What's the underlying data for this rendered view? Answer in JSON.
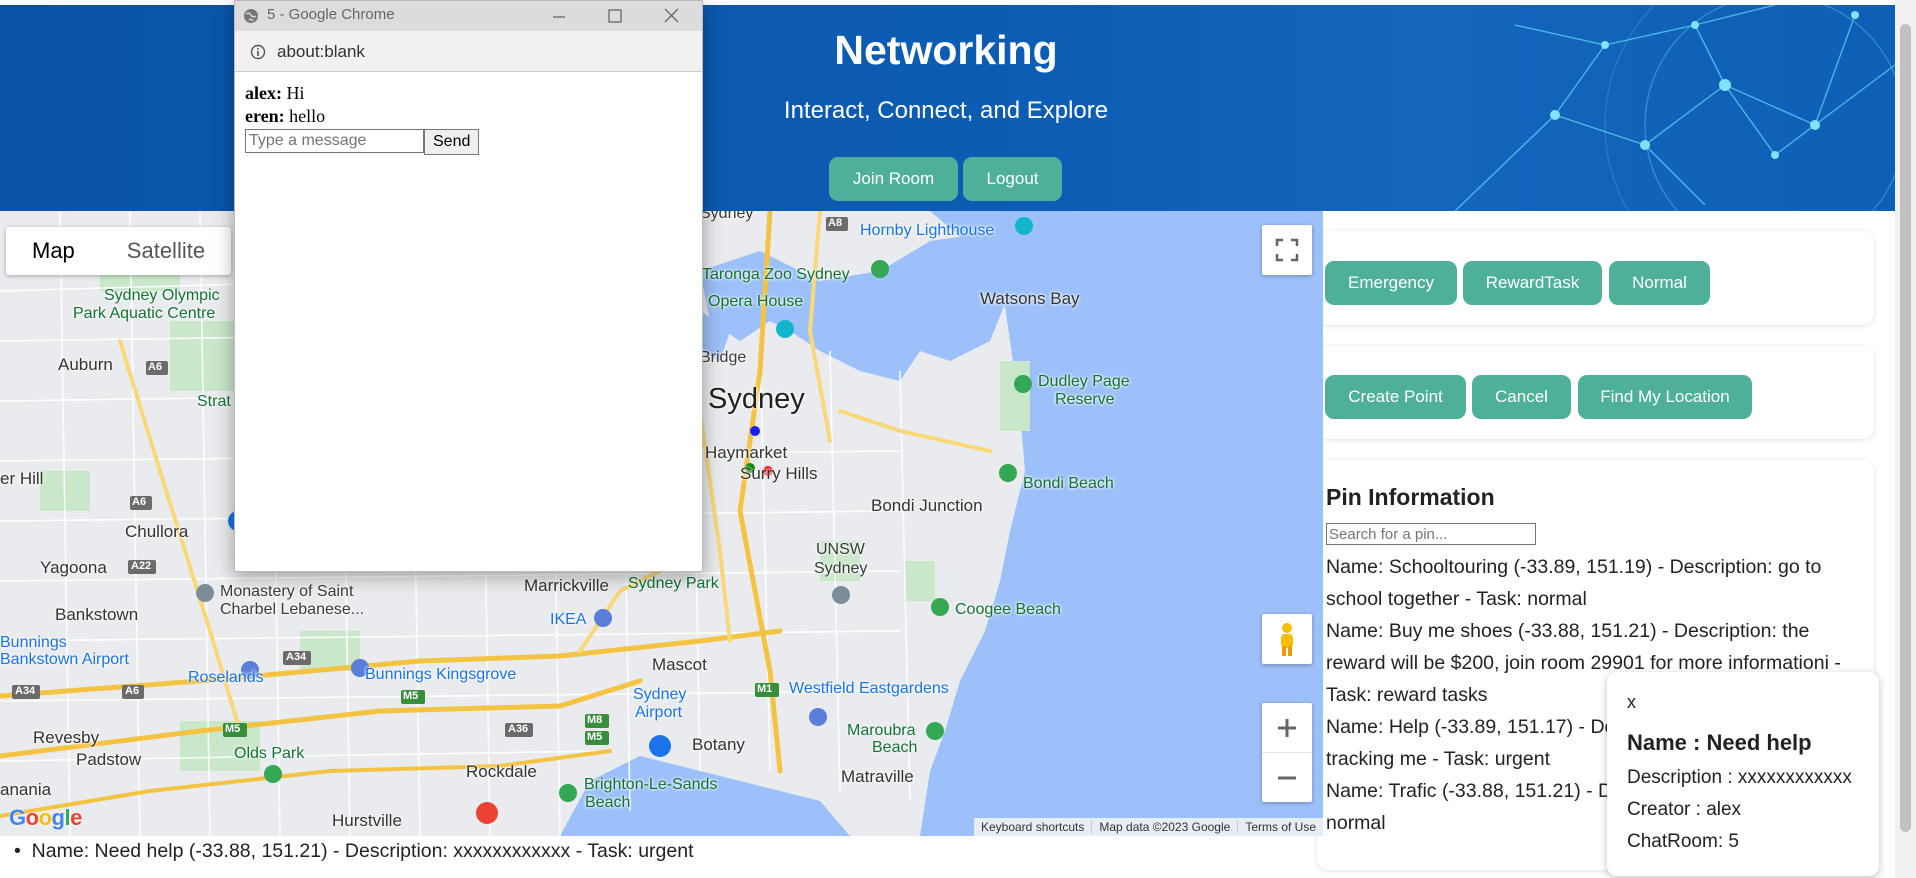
{
  "header": {
    "title": "Networking",
    "subtitle": "Interact, Connect, and Explore",
    "join_room": "Join Room",
    "logout": "Logout"
  },
  "filters": {
    "emergency": "Emergency",
    "reward_task": "RewardTask",
    "normal": "Normal"
  },
  "actions": {
    "create_point": "Create Point",
    "cancel": "Cancel",
    "find_location": "Find My Location"
  },
  "pins": {
    "title": "Pin Information",
    "search_placeholder": "Search for a pin...",
    "items": [
      "Name: Schooltouring (-33.89, 151.19) - Description: go to school together - Task: normal",
      "Name: Buy me shoes (-33.88, 151.21) - Description: the reward will be $200, join room 29901 for more informationi - Task: reward tasks",
      "Name: Help (-33.89, 151.17) - Description: someone is tracking me - Task: urgent",
      "Name: Trafic (-33.88, 151.21) - Description: traffic jam - Task: normal"
    ]
  },
  "popup": {
    "close": "x",
    "name": "Name : Need help",
    "description": "Description : xxxxxxxxxxxx",
    "creator": "Creator : alex",
    "chatroom": "ChatRoom: 5"
  },
  "bottom_list": {
    "item": "Name: Need help (-33.88, 151.21) - Description: xxxxxxxxxxxx - Task: urgent"
  },
  "map": {
    "type_map": "Map",
    "type_satellite": "Satellite",
    "google": "Google",
    "keyboard": "Keyboard shortcuts",
    "map_data": "Map data ©2023 Google",
    "terms": "Terms of Use",
    "labels": {
      "sydney": "Sydney",
      "haymarket": "Haymarket",
      "surry_hills": "Surry Hills",
      "watsons_bay": "Watsons Bay",
      "hornby": "Hornby Lighthouse",
      "taronga": "Taronga Zoo Sydney",
      "opera": "Opera House",
      "bridge": "Bridge",
      "dudley1": "Dudley Page",
      "dudley2": "Reserve",
      "bondi_beach": "Bondi Beach",
      "bondi_junction": "Bondi Junction",
      "unsw1": "UNSW",
      "unsw2": "Sydney",
      "coogee": "Coogee Beach",
      "maroubra1": "Maroubra",
      "maroubra2": "Beach",
      "westfield": "Westfield Eastgardens",
      "matraville": "Matraville",
      "botany": "Botany",
      "airport1": "Sydney",
      "airport2": "Airport",
      "mascot": "Mascot",
      "sydney_park": "Sydney Park",
      "marrickville": "Marrickville",
      "ikea": "IKEA",
      "bunnings_kg": "Bunnings Kingsgrove",
      "roselands": "Roselands",
      "bunnings_ba1": "Bunnings",
      "bunnings_ba2": "Bankstown Airport",
      "bankstown": "Bankstown",
      "yagoona": "Yagoona",
      "chullora": "Chullora",
      "monastery1": "Monastery of Saint",
      "monastery2": "Charbel Lebanese...",
      "auburn": "Auburn",
      "olympic1": "Sydney Olympic",
      "olympic2": "Park Aquatic Centre",
      "strat": "Strat",
      "er_hill": "er Hill",
      "revesby": "Revesby",
      "padstow": "Padstow",
      "olds_park": "Olds Park",
      "rockdale": "Rockdale",
      "brighton1": "Brighton-Le-Sands",
      "brighton2": "Beach",
      "hurstville": "Hurstville",
      "anania": "anania",
      "sydney_top": "Sydney"
    },
    "roads": {
      "a8": "A8",
      "a6a": "A6",
      "a6b": "A6",
      "a22": "A22",
      "a34a": "A34",
      "a34b": "A34",
      "m5a": "M5",
      "m5b": "M5",
      "m5c": "M5",
      "m8": "M8",
      "a36": "A36",
      "m1": "M1",
      "a6c": "A6"
    }
  },
  "chrome": {
    "title": "5 - Google Chrome",
    "url": "about:blank",
    "messages": [
      {
        "user": "alex:",
        "text": " Hi"
      },
      {
        "user": "eren:",
        "text": " hello"
      }
    ],
    "input_placeholder": "Type a message",
    "send": "Send"
  },
  "colors": {
    "banner": "#0c5db3",
    "teal": "#4fb09a",
    "water": "#9cc0f9"
  }
}
